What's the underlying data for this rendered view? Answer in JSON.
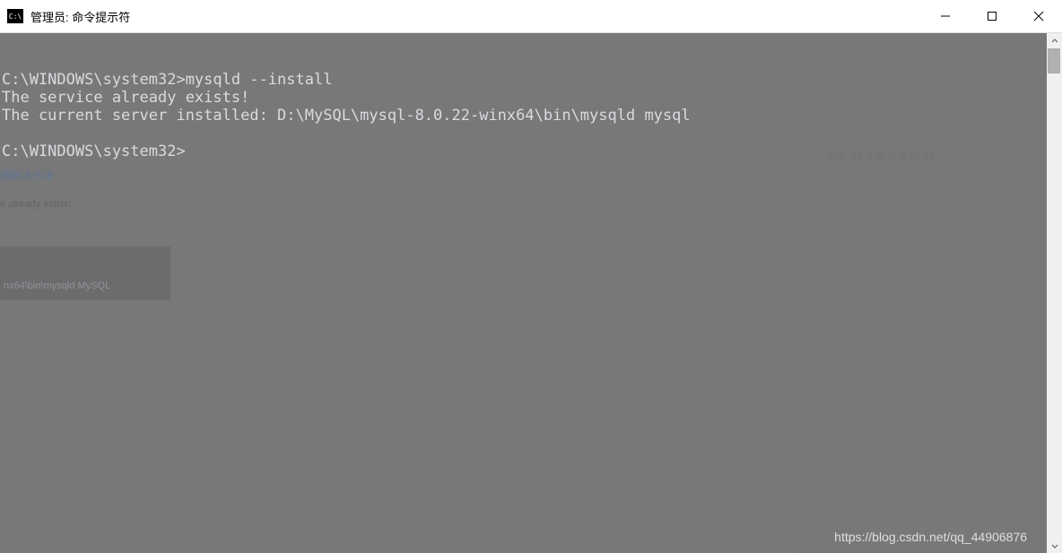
{
  "titlebar": {
    "title": "管理员: 命令提示符"
  },
  "terminal": {
    "line1": "C:\\WINDOWS\\system32>mysqld --install",
    "line2": "The service already exists!",
    "line3": "The current server installed: D:\\MySQL\\mysql-8.0.22-winx64\\bin\\mysqld mysql",
    "line4": "",
    "line5": "C:\\WINDOWS\\system32>"
  },
  "watermark": {
    "text": "https://blog.csdn.net/qq_44906876"
  },
  "background_artifacts": {
    "link_text": "器解决方法",
    "exists_text": "e already exists!",
    "box_text": "nx64\\bin\\mysqld MySQL",
    "stats_text": "阅读: 25  文章: 0  评分: 13"
  }
}
